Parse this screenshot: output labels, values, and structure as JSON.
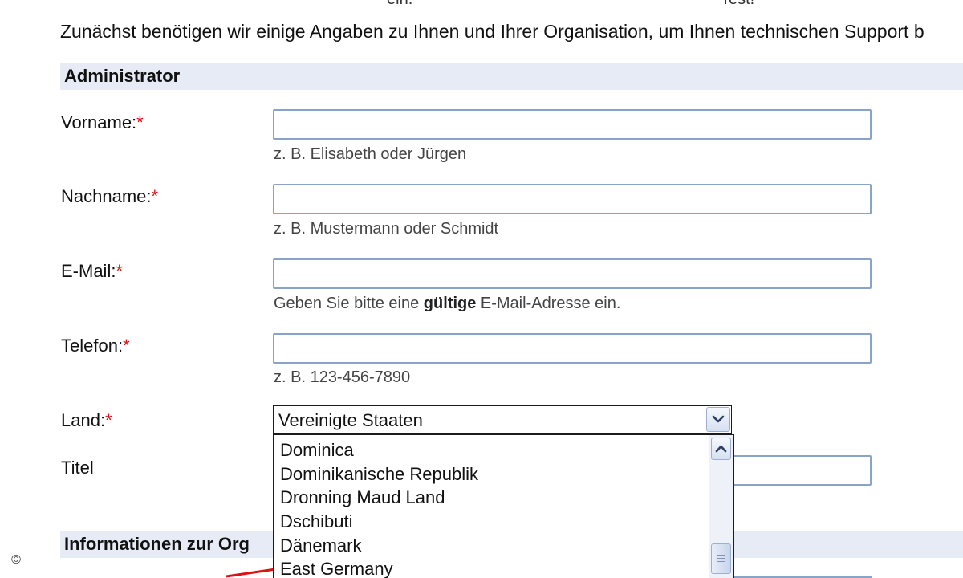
{
  "top_cut_text": {
    "left": "ein.",
    "right": "Test!"
  },
  "intro": "Zunächst benötigen wir einige Angaben zu Ihnen und Ihrer Organisation, um Ihnen technischen Support b",
  "sections": {
    "administrator": "Administrator",
    "organization": "Informationen zur Org"
  },
  "fields": {
    "vorname": {
      "label": "Vorname:",
      "required": "*",
      "value": "",
      "hint": "z. B. Elisabeth oder Jürgen"
    },
    "nachname": {
      "label": "Nachname:",
      "required": "*",
      "value": "",
      "hint": "z. B. Mustermann oder Schmidt"
    },
    "email": {
      "label": "E-Mail:",
      "required": "*",
      "value": "",
      "hint_pre": "Geben Sie bitte eine ",
      "hint_bold": "gültige",
      "hint_post": " E-Mail-Adresse ein."
    },
    "telefon": {
      "label": "Telefon:",
      "required": "*",
      "value": "",
      "hint": "z. B. 123-456-7890"
    },
    "land": {
      "label": "Land:",
      "required": "*",
      "selected": "Vereinigte Staaten"
    },
    "titel": {
      "label": "Titel",
      "value": ""
    }
  },
  "dropdown_options": [
    "Dominica",
    "Dominikanische Republik",
    "Dronning Maud Land",
    "Dschibuti",
    "Dänemark",
    "East Germany"
  ],
  "icons": {
    "select_toggle": "chevron-down-icon",
    "scroll_up": "chevron-up-icon",
    "copyright": "copyright-icon"
  },
  "copyright_symbol": "©",
  "colors": {
    "section_bar": "#e6ebf5",
    "required": "#e01010",
    "input_border": "#8aa3c8",
    "annotation_arrow": "#e01010"
  }
}
